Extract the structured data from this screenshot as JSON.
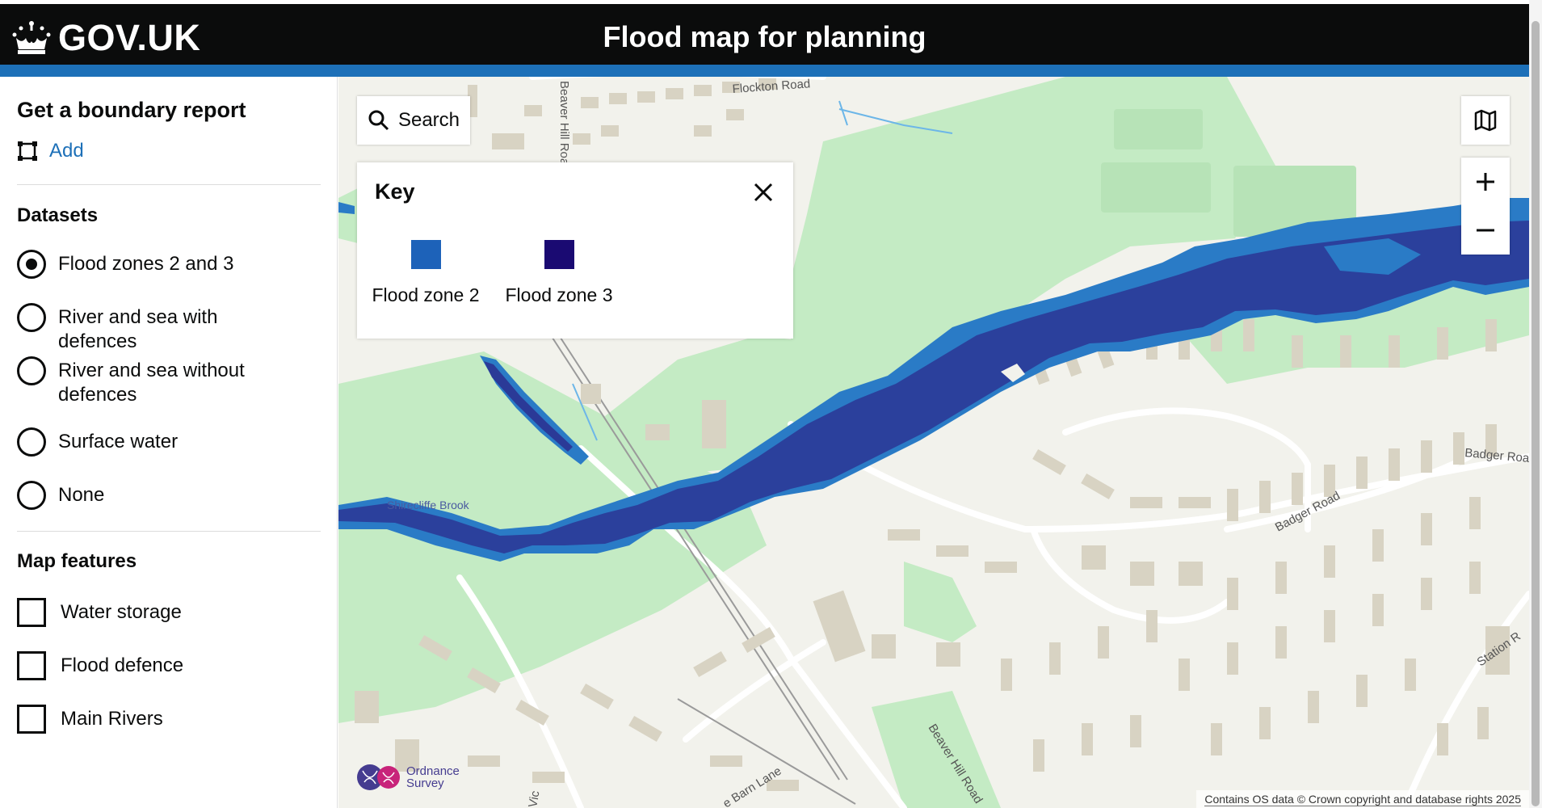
{
  "header": {
    "logo_text": "GOV.UK",
    "service_name": "Flood map for planning"
  },
  "sidebar": {
    "title": "Get a boundary report",
    "add_label": "Add",
    "datasets_heading": "Datasets",
    "datasets": [
      {
        "label": "Flood zones 2 and 3",
        "checked": true
      },
      {
        "label": "River and sea with defences",
        "checked": false
      },
      {
        "label": "River and sea without defences",
        "checked": false
      },
      {
        "label": "Surface water",
        "checked": false
      },
      {
        "label": "None",
        "checked": false
      }
    ],
    "features_heading": "Map features",
    "features": [
      {
        "label": "Water storage",
        "checked": false
      },
      {
        "label": "Flood defence",
        "checked": false
      },
      {
        "label": "Main Rivers",
        "checked": false
      }
    ]
  },
  "map": {
    "search_label": "Search",
    "key": {
      "title": "Key",
      "items": [
        {
          "label": "Flood zone 2",
          "color": "#1d62b9"
        },
        {
          "label": "Flood zone 3",
          "color": "#1a0a72"
        }
      ]
    },
    "labels": {
      "flockton_road": "Flockton Road",
      "beaver_hill_road_top": "Beaver Hill Road",
      "beaver_hill_road_bottom": "Beaver Hill Road",
      "badger_road": "Badger Road",
      "badger_road_east": "Badger Roa",
      "station_road": "Station R",
      "barn_lane": "e Barn Lane",
      "vic": "Vic",
      "brook": "Shirecliffe Brook"
    },
    "os_logo_line1": "Ordnance",
    "os_logo_line2": "Survey",
    "attribution": "Contains OS data © Crown copyright and database rights 2025"
  },
  "colors": {
    "header_bg": "#0b0c0c",
    "header_stripe": "#1d70b8",
    "link": "#1d70b8",
    "green_space": "#c4ebc4",
    "building": "#d8d3c3"
  }
}
